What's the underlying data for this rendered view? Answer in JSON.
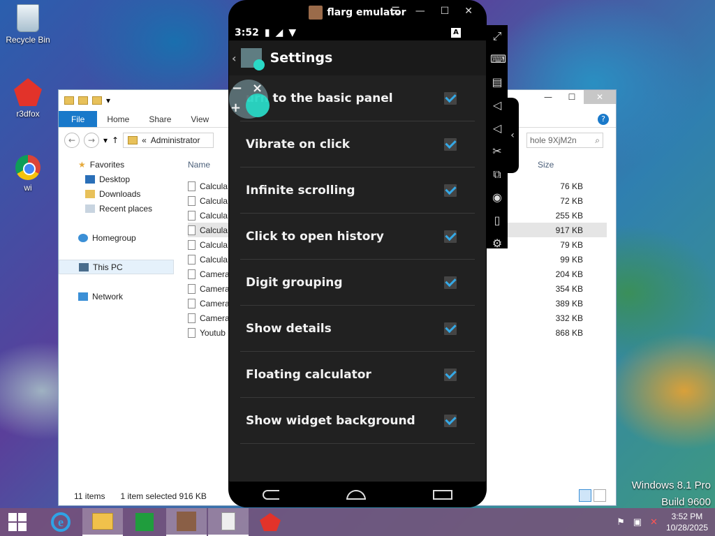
{
  "desktop": {
    "icons": [
      {
        "label": "Recycle Bin"
      },
      {
        "label": "r3dfox"
      },
      {
        "label": "wi"
      }
    ]
  },
  "explorer": {
    "ribbon_tabs": [
      "File",
      "Home",
      "Share",
      "View"
    ],
    "breadcrumb_prefix": "«",
    "breadcrumb": "Administrator",
    "search_text": "hole 9XjM2n",
    "nav": {
      "favorites": "Favorites",
      "desktop": "Desktop",
      "downloads": "Downloads",
      "recent": "Recent places",
      "homegroup": "Homegroup",
      "this_pc": "This PC",
      "network": "Network"
    },
    "columns": {
      "name": "Name",
      "size": "Size"
    },
    "files": [
      {
        "name": "Calcula",
        "size": "76 KB"
      },
      {
        "name": "Calcula",
        "size": "72 KB"
      },
      {
        "name": "Calcula",
        "size": "255 KB"
      },
      {
        "name": "Calcula",
        "size": "917 KB"
      },
      {
        "name": "Calcula",
        "size": "79 KB"
      },
      {
        "name": "Calcula",
        "size": "99 KB"
      },
      {
        "name": "Camera",
        "size": "204 KB"
      },
      {
        "name": "Camera",
        "size": "354 KB"
      },
      {
        "name": "Camera",
        "size": "389 KB"
      },
      {
        "name": "Camera",
        "size": "332 KB"
      },
      {
        "name": "Youtub",
        "size": "868 KB"
      }
    ],
    "status_items": "11 items",
    "status_selected": "1 item selected",
    "status_size": "916 KB"
  },
  "emulator": {
    "title": "flarg emulator",
    "status_time": "3:52",
    "action_title": "Settings",
    "settings": [
      "urn to the basic panel",
      "Vibrate on click",
      "Infinite scrolling",
      "Click to open history",
      "Digit grouping",
      "Show details",
      "Floating calculator",
      "Show widget background"
    ],
    "accent": "#2ad9c6",
    "check_color": "#35a9e6"
  },
  "watermark": {
    "line1": "Windows 8.1 Pro",
    "line2": "Build 9600"
  },
  "taskbar": {
    "time": "3:52 PM",
    "date": "10/28/2025"
  }
}
